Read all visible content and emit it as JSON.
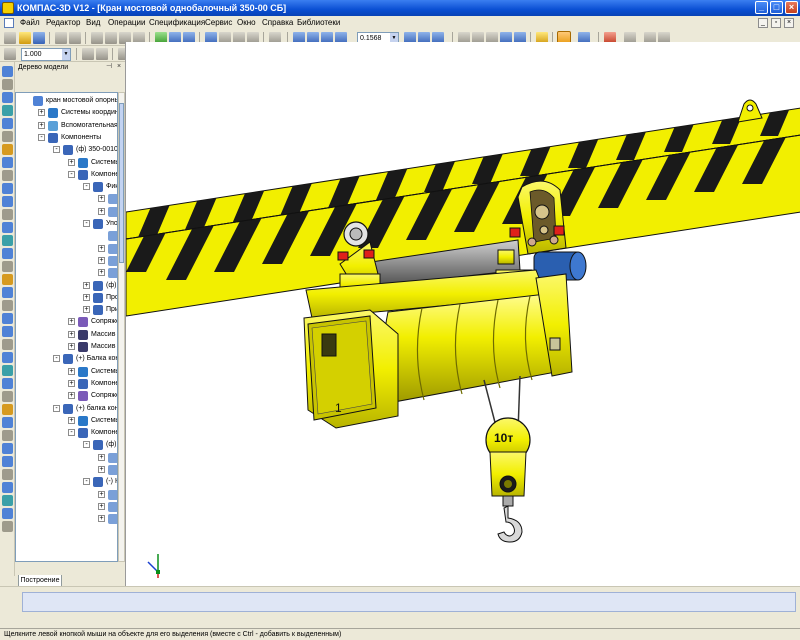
{
  "window": {
    "title": "КОМПАС-3D V12 - [Кран мостовой однобалочный  350-00 СБ]"
  },
  "menu": {
    "items": [
      "Файл",
      "Редактор",
      "Вид",
      "Операции",
      "Спецификация",
      "Сервис",
      "Окно",
      "Справка",
      "Библиотеки"
    ]
  },
  "toolbar": {
    "zoom_value": "0.1568",
    "scale_value": "1.000"
  },
  "tree_panel": {
    "title": "Дерево модели",
    "tab_label": "Построение",
    "rows": [
      {
        "label": "кран мостовой опорны",
        "icon": "assembly-icon",
        "indent": 0,
        "expander": ""
      },
      {
        "label": "Системы координ",
        "icon": "coordinate-system-icon",
        "indent": 1,
        "expander": "+"
      },
      {
        "label": "Вспомогательная",
        "icon": "auxiliary-geometry-icon",
        "indent": 1,
        "expander": "+"
      },
      {
        "label": "Компоненты",
        "icon": "components-icon",
        "indent": 1,
        "expander": "-"
      },
      {
        "label": "(ф) 350-0010",
        "icon": "subassembly-icon",
        "indent": 2,
        "expander": "-"
      },
      {
        "label": "Системы",
        "icon": "coordinate-system-icon",
        "indent": 3,
        "expander": "+"
      },
      {
        "label": "Компоне",
        "icon": "components-icon",
        "indent": 3,
        "expander": "-"
      },
      {
        "label": "Фикс",
        "icon": "subassembly-icon",
        "indent": 4,
        "expander": "-"
      },
      {
        "label": "",
        "icon": "part-icon",
        "indent": 5,
        "expander": "+"
      },
      {
        "label": "",
        "icon": "part-icon",
        "indent": 5,
        "expander": "+"
      },
      {
        "label": "Упор",
        "icon": "subassembly-icon",
        "indent": 4,
        "expander": "-"
      },
      {
        "label": "",
        "icon": "part-icon",
        "indent": 5,
        "expander": ""
      },
      {
        "label": "",
        "icon": "part-icon",
        "indent": 5,
        "expander": "+"
      },
      {
        "label": "",
        "icon": "part-icon",
        "indent": 5,
        "expander": "+"
      },
      {
        "label": "",
        "icon": "part-icon",
        "indent": 5,
        "expander": "+"
      },
      {
        "label": "(ф) I",
        "icon": "subassembly-icon",
        "indent": 4,
        "expander": "+"
      },
      {
        "label": "Проу",
        "icon": "subassembly-icon",
        "indent": 4,
        "expander": "+"
      },
      {
        "label": "Прис",
        "icon": "subassembly-icon",
        "indent": 4,
        "expander": "+"
      },
      {
        "label": "Сопряже",
        "icon": "mate-icon",
        "indent": 3,
        "expander": "+"
      },
      {
        "label": "Массив п",
        "icon": "array-icon",
        "indent": 3,
        "expander": "+"
      },
      {
        "label": "Массив п",
        "icon": "array-icon",
        "indent": 3,
        "expander": "+"
      },
      {
        "label": "(+) Балка конц",
        "icon": "subassembly-icon",
        "indent": 2,
        "expander": "-"
      },
      {
        "label": "Системы",
        "icon": "coordinate-system-icon",
        "indent": 3,
        "expander": "+"
      },
      {
        "label": "Компоне",
        "icon": "components-icon",
        "indent": 3,
        "expander": "+"
      },
      {
        "label": "Сопряже",
        "icon": "mate-icon",
        "indent": 3,
        "expander": "+"
      },
      {
        "label": "(+) балка конц",
        "icon": "subassembly-icon",
        "indent": 2,
        "expander": "-"
      },
      {
        "label": "Системы",
        "icon": "coordinate-system-icon",
        "indent": 3,
        "expander": "+"
      },
      {
        "label": "Компоне",
        "icon": "components-icon",
        "indent": 3,
        "expander": "-"
      },
      {
        "label": "(ф) I",
        "icon": "subassembly-icon",
        "indent": 4,
        "expander": "-"
      },
      {
        "label": "",
        "icon": "part-icon",
        "indent": 5,
        "expander": "+"
      },
      {
        "label": "",
        "icon": "part-icon",
        "indent": 5,
        "expander": "+"
      },
      {
        "label": "(-) К",
        "icon": "subassembly-icon",
        "indent": 4,
        "expander": "-"
      },
      {
        "label": "",
        "icon": "part-icon",
        "indent": 5,
        "expander": "+"
      },
      {
        "label": "",
        "icon": "part-icon",
        "indent": 5,
        "expander": "+"
      },
      {
        "label": "",
        "icon": "part-icon",
        "indent": 5,
        "expander": "+"
      }
    ]
  },
  "model": {
    "hook_capacity_label": "10т",
    "colors": {
      "body": "#f2ef00",
      "stripe": "#1a1a1a",
      "accent_red": "#e0201a",
      "motor_blue": "#2a5fb0",
      "axle_gray": "#8c8c8c"
    }
  },
  "status": {
    "text": "Щелкните левой кнопкой мыши на объекте для его выделения (вместе с Ctrl - добавить к выделенным)"
  }
}
